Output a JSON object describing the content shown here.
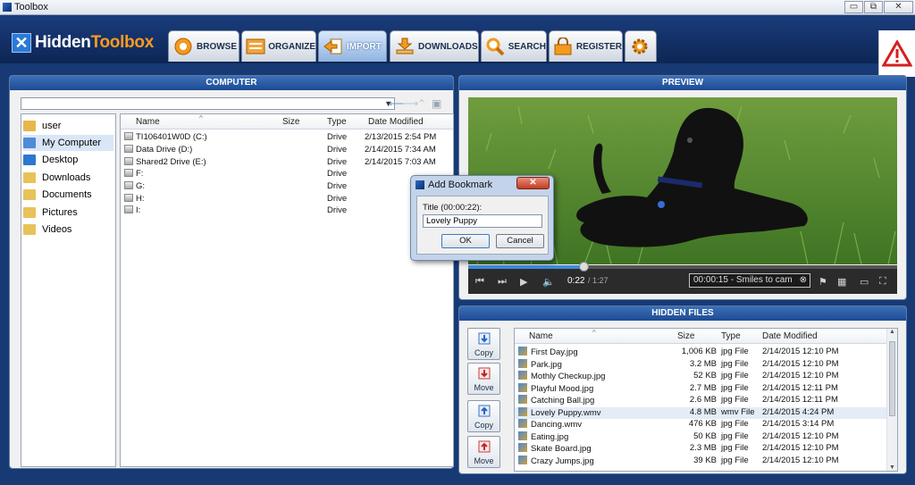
{
  "window": {
    "title": "Toolbox",
    "minimize": "▭",
    "restore": "⧉",
    "close": "✕"
  },
  "app": {
    "logo_a": "Hidden",
    "logo_b": "Toolbox",
    "logo_mark": "✕"
  },
  "tabs": [
    {
      "label": "BROWSE",
      "icon": "browse-icon"
    },
    {
      "label": "ORGANIZE",
      "icon": "organize-icon"
    },
    {
      "label": "IMPORT",
      "icon": "import-icon",
      "active": true
    },
    {
      "label": "DOWNLOADS",
      "icon": "downloads-icon"
    },
    {
      "label": "SEARCH",
      "icon": "search-icon"
    },
    {
      "label": "REGISTER",
      "icon": "register-icon"
    },
    {
      "label": "",
      "icon": "settings-icon"
    }
  ],
  "computer": {
    "title": "COMPUTER",
    "tree": [
      "user",
      "My Computer",
      "Desktop",
      "Downloads",
      "Documents",
      "Pictures",
      "Videos"
    ],
    "selected_tree": "My Computer",
    "columns": {
      "name": "Name",
      "size": "Size",
      "type": "Type",
      "date": "Date Modified"
    },
    "rows": [
      {
        "name": "TI106401W0D (C:)",
        "size": "",
        "type": "Drive",
        "date": "2/13/2015 2:54 PM"
      },
      {
        "name": "Data Drive (D:)",
        "size": "",
        "type": "Drive",
        "date": "2/14/2015 7:34 AM"
      },
      {
        "name": "Shared2 Drive (E:)",
        "size": "",
        "type": "Drive",
        "date": "2/14/2015 7:03 AM"
      },
      {
        "name": "F:",
        "size": "",
        "type": "Drive",
        "date": ""
      },
      {
        "name": "G:",
        "size": "",
        "type": "Drive",
        "date": ""
      },
      {
        "name": "H:",
        "size": "",
        "type": "Drive",
        "date": ""
      },
      {
        "name": "I:",
        "size": "",
        "type": "Drive",
        "date": ""
      }
    ]
  },
  "preview": {
    "title": "PREVIEW",
    "time_current": "0:22",
    "time_total": "/ 1:27",
    "progress": 0.27,
    "bookmark": "00:00:15 - Smiles to cam"
  },
  "hidden_files": {
    "title": "HIDDEN FILES",
    "buttons": [
      "Copy",
      "Move",
      "Copy",
      "Move"
    ],
    "columns": {
      "name": "Name",
      "size": "Size",
      "type": "Type",
      "date": "Date Modified"
    },
    "rows": [
      {
        "name": "First Day.jpg",
        "size": "1,006 KB",
        "type": "jpg File",
        "date": "2/14/2015 12:10 PM"
      },
      {
        "name": "Park.jpg",
        "size": "3.2 MB",
        "type": "jpg File",
        "date": "2/14/2015 12:10 PM"
      },
      {
        "name": "Mothly Checkup.jpg",
        "size": "52 KB",
        "type": "jpg File",
        "date": "2/14/2015 12:10 PM"
      },
      {
        "name": "Playful Mood.jpg",
        "size": "2.7 MB",
        "type": "jpg File",
        "date": "2/14/2015 12:11 PM"
      },
      {
        "name": "Catching Ball.jpg",
        "size": "2.6 MB",
        "type": "jpg File",
        "date": "2/14/2015 12:11 PM"
      },
      {
        "name": "Lovely Puppy.wmv",
        "size": "4.8 MB",
        "type": "wmv File",
        "date": "2/14/2015 4:24 PM"
      },
      {
        "name": "Dancing.wmv",
        "size": "476 KB",
        "type": "jpg File",
        "date": "2/14/2015 3:14 PM"
      },
      {
        "name": "Eating.jpg",
        "size": "50 KB",
        "type": "jpg File",
        "date": "2/14/2015 12:10 PM"
      },
      {
        "name": "Skate Board.jpg",
        "size": "2.3 MB",
        "type": "jpg File",
        "date": "2/14/2015 12:10 PM"
      },
      {
        "name": "Crazy Jumps.jpg",
        "size": "39 KB",
        "type": "jpg File",
        "date": "2/14/2015 12:10 PM"
      }
    ]
  },
  "dialog": {
    "title": "Add Bookmark",
    "close": "✕",
    "label": "Title (00:00:22):",
    "value": "Lovely Puppy",
    "ok": "OK",
    "cancel": "Cancel"
  },
  "colors": {
    "accent": "#1c4b94",
    "brand_orange": "#ff9a1f",
    "header_bg": "#0d2654"
  }
}
